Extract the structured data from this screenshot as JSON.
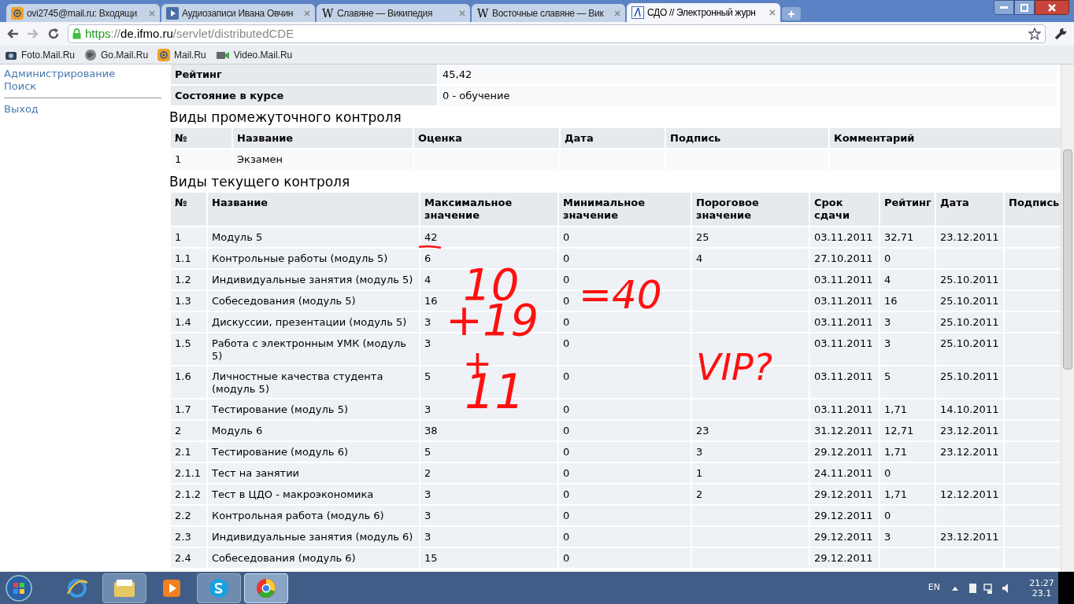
{
  "tabs": [
    {
      "title": "ovi2745@mail.ru: Входящи",
      "kind": "mail",
      "selected": false
    },
    {
      "title": "Аудиозаписи Ивана Овчин",
      "kind": "audio",
      "selected": false
    },
    {
      "title": "Славяне — Википедия",
      "kind": "wiki",
      "icon_text": "W",
      "selected": false
    },
    {
      "title": "Восточные славяне — Вик",
      "kind": "wiki",
      "icon_text": "W",
      "selected": false
    },
    {
      "title": "СДО // Электронный журн",
      "kind": "sdo",
      "selected": true
    }
  ],
  "address": {
    "scheme": "https",
    "separator": "://",
    "host": "de.ifmo.ru",
    "path": "/servlet/distributedCDE"
  },
  "bookmarks": [
    {
      "label": "Foto.Mail.Ru",
      "kind": "camera"
    },
    {
      "label": "Go.Mail.Ru",
      "kind": "globe"
    },
    {
      "label": "Mail.Ru",
      "kind": "mail"
    },
    {
      "label": "Video.Mail.Ru",
      "kind": "video"
    }
  ],
  "sidebar": {
    "items_top": [
      "Администрирование",
      "Поиск"
    ],
    "items_bottom": [
      "Выход"
    ]
  },
  "info_rows": [
    {
      "label": "Рейтинг",
      "value": "45,42"
    },
    {
      "label": "Состояние в курсе",
      "value": "0 - обучение"
    }
  ],
  "intermediate": {
    "title": "Виды промежуточного контроля",
    "columns": [
      "№",
      "Название",
      "Оценка",
      "Дата",
      "Подпись",
      "Комментарий"
    ],
    "rows": [
      [
        "1",
        "Экзамен",
        null,
        null,
        null,
        null
      ]
    ]
  },
  "current": {
    "title": "Виды текущего контроля",
    "columns": [
      "№",
      "Название",
      "Максимальное значение",
      "Минимальное значение",
      "Пороговое значение",
      "Срок сдачи",
      "Рейтинг",
      "Дата",
      "Подпись"
    ],
    "rows": [
      [
        "1",
        "Модуль 5",
        "42",
        "0",
        "25",
        "03.11.2011",
        "32,71",
        "23.12.2011",
        null
      ],
      [
        "1.1",
        "Контрольные работы (модуль 5)",
        "6",
        "0",
        "4",
        "27.10.2011",
        "0",
        null,
        null
      ],
      [
        "1.2",
        "Индивидуальные занятия (модуль 5)",
        "4",
        "0",
        null,
        "03.11.2011",
        "4",
        "25.10.2011",
        null
      ],
      [
        "1.3",
        "Собеседования (модуль 5)",
        "16",
        "0",
        null,
        "03.11.2011",
        "16",
        "25.10.2011",
        null
      ],
      [
        "1.4",
        "Дискуссии, презентации (модуль 5)",
        "3",
        "0",
        null,
        "03.11.2011",
        "3",
        "25.10.2011",
        null
      ],
      [
        "1.5",
        "Работа с электронным УМК (модуль 5)",
        "3",
        "0",
        null,
        "03.11.2011",
        "3",
        "25.10.2011",
        null
      ],
      [
        "1.6",
        "Личностные качества студента (модуль 5)",
        "5",
        "0",
        null,
        "03.11.2011",
        "5",
        "25.10.2011",
        null
      ],
      [
        "1.7",
        "Тестирование (модуль 5)",
        "3",
        "0",
        null,
        "03.11.2011",
        "1,71",
        "14.10.2011",
        null
      ],
      [
        "2",
        "Модуль 6",
        "38",
        "0",
        "23",
        "31.12.2011",
        "12,71",
        "23.12.2011",
        null
      ],
      [
        "2.1",
        "Тестирование (модуль 6)",
        "5",
        "0",
        "3",
        "29.12.2011",
        "1,71",
        "23.12.2011",
        null
      ],
      [
        "2.1.1",
        "Тест на занятии",
        "2",
        "0",
        "1",
        "24.11.2011",
        "0",
        null,
        null
      ],
      [
        "2.1.2",
        "Тест в ЦДО - макроэкономика",
        "3",
        "0",
        "2",
        "29.12.2011",
        "1,71",
        "12.12.2011",
        null
      ],
      [
        "2.2",
        "Контрольная работа (модуль 6)",
        "3",
        "0",
        null,
        "29.12.2011",
        "0",
        null,
        null
      ],
      [
        "2.3",
        "Индивидуальные занятия (модуль 6)",
        "3",
        "0",
        null,
        "29.12.2011",
        "3",
        "23.12.2011",
        null
      ],
      [
        "2.4",
        "Собеседования (модуль 6)",
        "15",
        "0",
        null,
        "29.12.2011",
        null,
        null,
        null
      ]
    ]
  },
  "annotations": [
    "10",
    "+19",
    "+",
    "11",
    "=40",
    "VIP?"
  ],
  "taskbar": {
    "language": "EN",
    "time": "21:27",
    "date": "23.1"
  }
}
